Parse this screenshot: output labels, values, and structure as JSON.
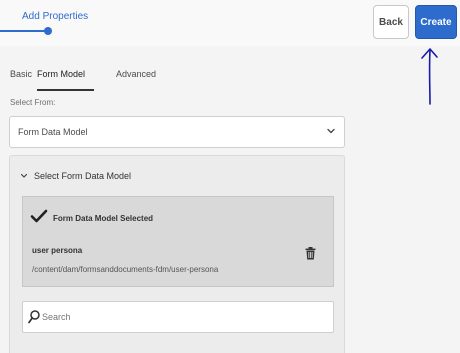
{
  "header": {
    "step_label": "Add Properties",
    "back_label": "Back",
    "create_label": "Create"
  },
  "tabs": [
    {
      "label": "Basic",
      "active": false
    },
    {
      "label": "Form Model",
      "active": true
    },
    {
      "label": "Advanced",
      "active": false
    }
  ],
  "form": {
    "select_from_label": "Select From:",
    "select_from_value": "Form Data Model"
  },
  "panel": {
    "title": "Select Form Data Model",
    "selected_card": {
      "status": "Form Data Model Selected",
      "name": "user persona",
      "path": "/content/dam/formsanddocuments-fdm/user-persona"
    },
    "search": {
      "placeholder": "Search"
    }
  },
  "colors": {
    "accent": "#2d6ccc",
    "annotation": "#1a1aa8"
  },
  "icons": [
    "chevron-down-icon",
    "checkmark-icon",
    "trash-icon",
    "search-icon"
  ]
}
